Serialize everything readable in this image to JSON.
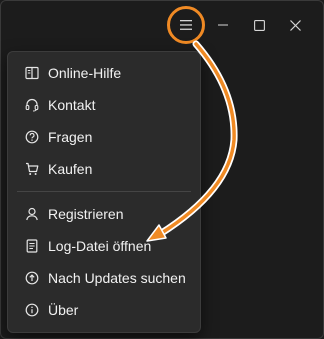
{
  "titlebar": {
    "menu_icon": "hamburger-icon",
    "minimize_icon": "minimize-icon",
    "maximize_icon": "maximize-icon",
    "close_icon": "close-icon"
  },
  "menu": {
    "items": [
      {
        "label": "Online-Hilfe",
        "icon": "book-icon"
      },
      {
        "label": "Kontakt",
        "icon": "headset-icon"
      },
      {
        "label": "Fragen",
        "icon": "question-icon"
      },
      {
        "label": "Kaufen",
        "icon": "cart-icon"
      },
      {
        "label": "Registrieren",
        "icon": "person-icon"
      },
      {
        "label": "Log-Datei öffnen",
        "icon": "document-icon"
      },
      {
        "label": "Nach Updates suchen",
        "icon": "upload-icon"
      },
      {
        "label": "Über",
        "icon": "info-icon"
      }
    ]
  },
  "annotation": {
    "color": "#f08a24"
  }
}
